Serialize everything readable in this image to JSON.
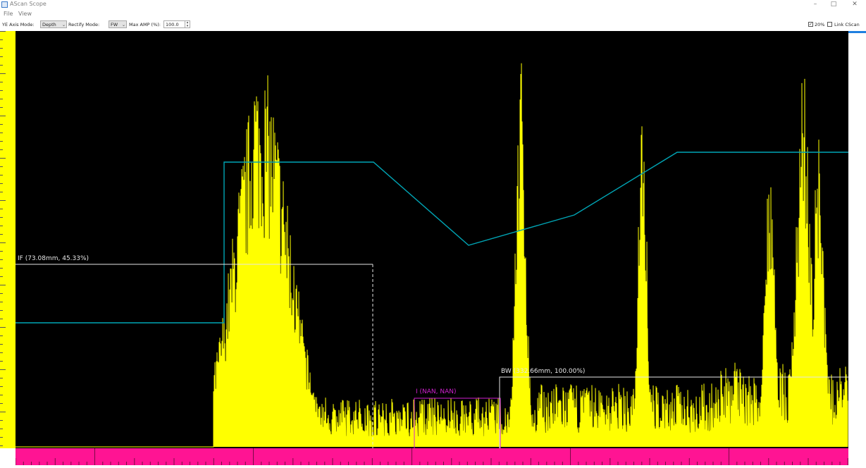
{
  "window": {
    "title": "AScan Scope",
    "controls": {
      "minimize": "–",
      "maximize": "□",
      "close": "✕"
    }
  },
  "menu": {
    "items": [
      "File",
      "View"
    ]
  },
  "toolbar": {
    "ye_axis_mode_label": "YE Axis Mode:",
    "ye_axis_mode_value": "Depth",
    "rectify_mode_label": "Rectify Mode:",
    "rectify_mode_value": "FW",
    "max_amp_label": "Max AMP (%):",
    "max_amp_value": "100.0",
    "checkbox1_label": "20%",
    "checkbox1_checked": true,
    "checkbox2_label": "Link CScan",
    "checkbox2_checked": false
  },
  "gates": {
    "if_label": "IF  (73.08mm, 45.33%)",
    "i_label": "I  (NAN, NAN)",
    "bw_label": "BW  (332.66mm, 100.00%)",
    "if_color": "#e6e6e6",
    "i_color": "#d020d0",
    "bw_color": "#e6e6e6"
  },
  "colors": {
    "signal": "#ffff00",
    "tcg_curve": "#00a5b5",
    "ruler": "#ffff00",
    "bottom_axis": "#ff1493",
    "plot_bg": "#000000"
  },
  "icons": {
    "app": "window-icon",
    "check": "checkmark"
  }
}
